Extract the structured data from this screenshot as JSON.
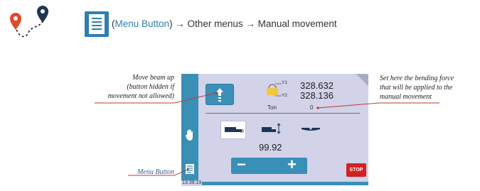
{
  "header": {
    "route_icon": "route-pins-icon",
    "menu_icon": "menu-list-icon",
    "nav_paren_open": "(",
    "nav_link": "Menu Button",
    "nav_rest": ") → Other menus → Manual movement"
  },
  "screen": {
    "y1_label": "Y1",
    "y2_label": "Y2",
    "y1_value": "328.632",
    "y2_value": "328.136",
    "ton_label": "Ton",
    "force_value": "0",
    "speed_value": "99.92",
    "minus_label": "−",
    "plus_label": "+",
    "stop_label": "STOP",
    "clock": "13:39:19"
  },
  "annotations": {
    "up_line1": "Move beam up",
    "up_line2": "(button hidden if",
    "up_line3": "movement not allowed)",
    "menu_button": "Menu Button",
    "force_line1": "Set here the bending force",
    "force_line2": "that will be applied to the",
    "force_line3": "manual movement"
  },
  "colors": {
    "accent_blue": "#2f7fae",
    "screen_bg": "#d2d2e8",
    "stop_red": "#d42020",
    "pin_red": "#e04a2a",
    "pin_navy": "#1f3552"
  }
}
